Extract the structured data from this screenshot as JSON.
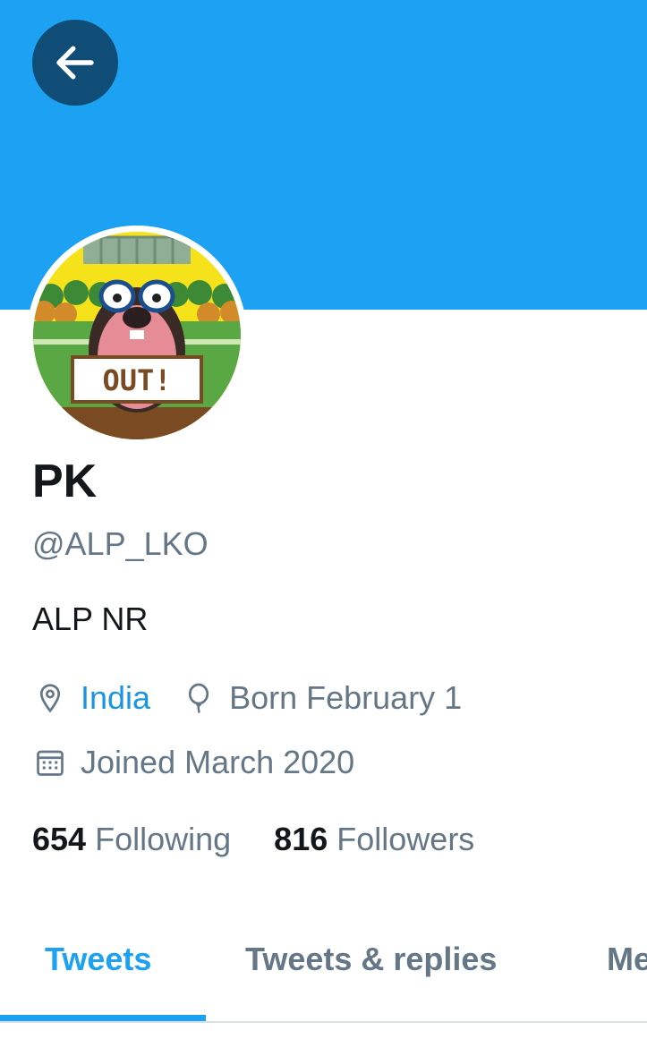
{
  "colors": {
    "banner": "#1da1f2",
    "accent": "#1da1f2",
    "link": "#1b95e0",
    "muted": "#657786",
    "back_button": "#0f4d76"
  },
  "header": {
    "back_icon": "arrow-left-icon"
  },
  "avatar": {
    "sign_text": "OUT!"
  },
  "profile": {
    "name": "PK",
    "handle": "@ALP_LKO",
    "bio": "ALP NR",
    "location": "India",
    "birthday": "Born February 1",
    "joined": "Joined March 2020"
  },
  "stats": {
    "following_count": "654",
    "following_label": "Following",
    "followers_count": "816",
    "followers_label": "Followers"
  },
  "tabs": [
    {
      "label": "Tweets",
      "active": true
    },
    {
      "label": "Tweets & replies",
      "active": false
    },
    {
      "label": "Me",
      "active": false
    }
  ]
}
